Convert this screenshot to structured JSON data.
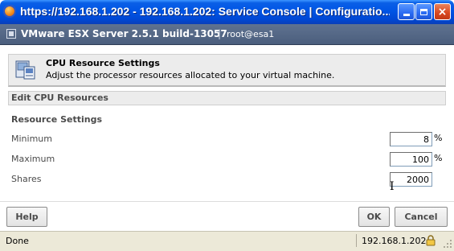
{
  "window": {
    "title": "https://192.168.1.202 - 192.168.1.202: Service Console | Configuratio...",
    "controls": {
      "minimize": "minimize",
      "maximize": "maximize",
      "close": "×"
    }
  },
  "header": {
    "product": "VMware ESX Server 2.5.1 build-13057",
    "separator": "|",
    "user": "root@esa1"
  },
  "panel": {
    "title": "CPU Resource Settings",
    "subtitle": "Adjust the processor resources allocated to your virtual machine.",
    "edit_bar": "Edit CPU Resources",
    "section": "Resource Settings",
    "rows": [
      {
        "label": "Minimum",
        "value": "8",
        "unit": "%"
      },
      {
        "label": "Maximum",
        "value": "100",
        "unit": "%"
      },
      {
        "label": "Shares",
        "value": "2000",
        "unit": ""
      }
    ]
  },
  "buttons": {
    "help": "Help",
    "ok": "OK",
    "cancel": "Cancel"
  },
  "status": {
    "text": "Done",
    "host": "192.168.1.202"
  },
  "icons": {
    "app": "firefox-icon",
    "header": "vmware-logo-icon",
    "panel": "cpu-icon",
    "status": "lock-icon",
    "cursor": "text-cursor-icon"
  },
  "colors": {
    "titlebar": "#0055e5",
    "header_bg": "#4b5e7d",
    "panel_bg": "#ececec",
    "statusbar_bg": "#ece9d8"
  }
}
